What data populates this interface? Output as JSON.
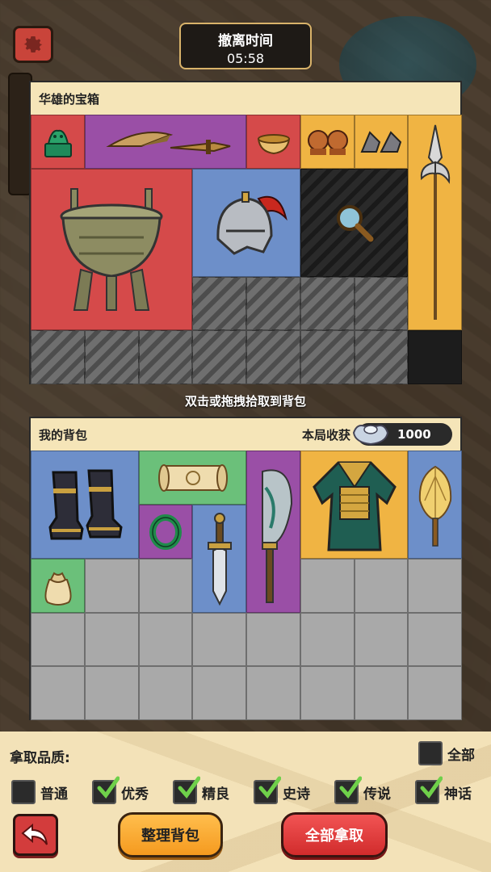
{
  "timer": {
    "title": "撤离时间",
    "time": "05:58"
  },
  "chest": {
    "title": "华雄的宝箱",
    "hint": "双击或拖拽拾取到背包",
    "items": [
      {
        "name": "jade-seal-icon",
        "rarity": "red"
      },
      {
        "name": "twin-daggers-icon",
        "rarity": "purple"
      },
      {
        "name": "bowl-icon",
        "rarity": "red"
      },
      {
        "name": "tiger-figurines-icon",
        "rarity": "gold"
      },
      {
        "name": "iron-tiger-figurines-icon",
        "rarity": "gold"
      },
      {
        "name": "halberd-icon",
        "rarity": "gold"
      },
      {
        "name": "bronze-ding-icon",
        "rarity": "red"
      },
      {
        "name": "helmet-icon",
        "rarity": "blue"
      },
      {
        "name": "search-icon",
        "rarity": "unrevealed"
      }
    ]
  },
  "bag": {
    "title": "我的背包",
    "harvest_label": "本局收获",
    "silver": "1000",
    "items": [
      {
        "name": "boots-icon",
        "rarity": "blue"
      },
      {
        "name": "scroll-icon",
        "rarity": "green"
      },
      {
        "name": "jade-bracelet-icon",
        "rarity": "purple"
      },
      {
        "name": "short-sword-icon",
        "rarity": "blue"
      },
      {
        "name": "glaive-icon",
        "rarity": "purple"
      },
      {
        "name": "armor-robe-icon",
        "rarity": "gold"
      },
      {
        "name": "feather-fan-icon",
        "rarity": "gold"
      },
      {
        "name": "money-pouch-icon",
        "rarity": "green"
      }
    ]
  },
  "controls": {
    "quality_label": "拿取品质:",
    "all_label": "全部",
    "qualities": [
      {
        "label": "普通",
        "checked": false
      },
      {
        "label": "优秀",
        "checked": true
      },
      {
        "label": "精良",
        "checked": true
      },
      {
        "label": "史诗",
        "checked": true
      },
      {
        "label": "传说",
        "checked": true
      },
      {
        "label": "神话",
        "checked": true
      }
    ],
    "sort_label": "整理背包",
    "take_all_label": "全部拿取"
  },
  "colors": {
    "red": "#d54a4a",
    "purple": "#9a4fa6",
    "blue": "#6d8fc9",
    "gold": "#f0b443",
    "green": "#6bc07a",
    "accent_red": "#d33c3c"
  }
}
